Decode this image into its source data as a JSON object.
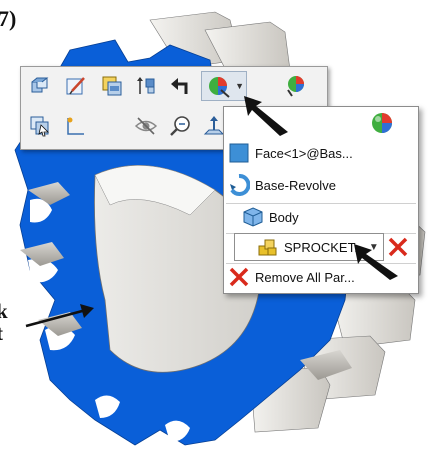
{
  "figure": {
    "step_label": "7)",
    "callout_line1": "k",
    "callout_line2": "t"
  },
  "toolbar": {
    "row1": [
      {
        "name": "view-orientation-icon",
        "icon": "cube-views"
      },
      {
        "name": "edit-sketch-icon",
        "icon": "pencil-sketch"
      },
      {
        "name": "edit-feature-icon",
        "icon": "feature-edit"
      },
      {
        "name": "rollback-icon",
        "icon": "rollback-bar"
      },
      {
        "name": "go-to-parent-icon",
        "icon": "return-arrow"
      },
      {
        "name": "appearances-icon",
        "icon": "color-ball-pencil"
      },
      {
        "name": "appearance-dropdown-icon",
        "icon": "chevron-down"
      },
      {
        "name": "appearance-callout-icon",
        "icon": "color-ball-arrow"
      }
    ],
    "row2": [
      {
        "name": "select-other-icon",
        "icon": "select-other"
      },
      {
        "name": "sketch-grid-icon",
        "icon": "sketch-plane"
      },
      {
        "name": "hide-icon",
        "icon": "eye-crossed"
      },
      {
        "name": "zoom-to-selection-icon",
        "icon": "magnifier"
      },
      {
        "name": "normal-to-icon",
        "icon": "normal-to"
      }
    ]
  },
  "menu": {
    "items": [
      {
        "label": "Face<1>@Bas...",
        "icon": "face-square",
        "color": "#3d8fd6"
      },
      {
        "label": "Base-Revolve",
        "icon": "revolve",
        "color": "#3d8fd6"
      },
      {
        "label": "Body",
        "icon": "body-cube",
        "color": "#3d8fd6"
      },
      {
        "label": "SPROCKET...",
        "icon": "part-blocks",
        "color": "#e8c02a"
      },
      {
        "label": "Remove All Par...",
        "icon": "red-x",
        "color": "#d92a1c"
      }
    ]
  },
  "colors": {
    "sprocket_blue": "#0a5fd8",
    "tooth_top": "#e8e6e2",
    "tooth_side": "#b3b0aa",
    "remove_red": "#d92a1c"
  }
}
